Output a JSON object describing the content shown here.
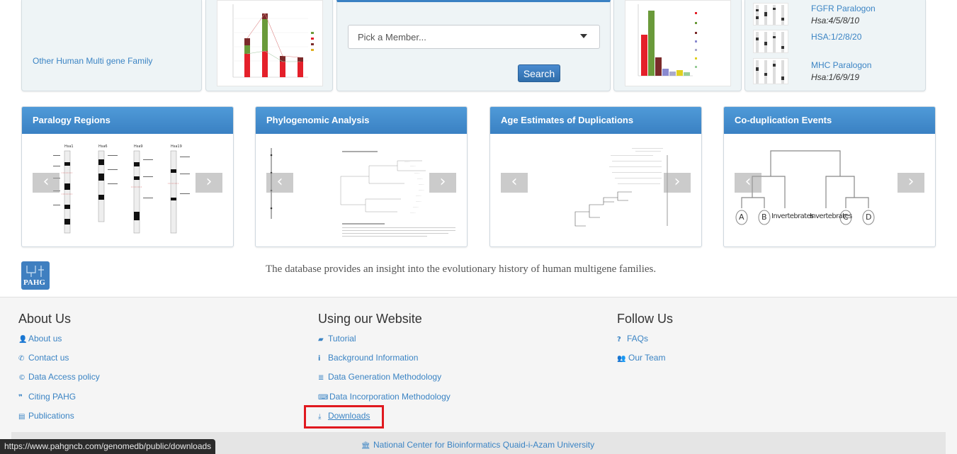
{
  "top_row": {
    "family_link": "Other Human Multi gene Family",
    "member_select_placeholder": "Pick a Member...",
    "search_button": "Search",
    "paralogons": [
      {
        "name": "FGFR Paralogon",
        "hsa": "Hsa:4/5/8/10"
      },
      {
        "name": "HSA:1/2/8/20",
        "hsa": ""
      },
      {
        "name": "MHC Paralogon",
        "hsa": "Hsa:1/6/9/19"
      }
    ]
  },
  "panels": [
    {
      "title": "Paralogy Regions"
    },
    {
      "title": "Phylogenomic Analysis"
    },
    {
      "title": "Age Estimates of Duplications"
    },
    {
      "title": "Co-duplication Events"
    }
  ],
  "tree_labels": [
    "A",
    "B",
    "Invertebrates",
    "Invertebrates",
    "C",
    "D"
  ],
  "logo_text": "PAHG",
  "tagline": "The database provides an insight into the evolutionary history of human multigene families.",
  "footer": {
    "about": {
      "title": "About Us",
      "items": [
        {
          "label": "About us",
          "icon": "user-icon"
        },
        {
          "label": "Contact us",
          "icon": "phone-icon"
        },
        {
          "label": "Data Access policy",
          "icon": "copyright-icon"
        },
        {
          "label": "Citing PAHG",
          "icon": "quote-icon"
        },
        {
          "label": "Publications",
          "icon": "newspaper-icon"
        }
      ]
    },
    "using": {
      "title": "Using our Website",
      "items": [
        {
          "label": "Tutorial",
          "icon": "book-icon"
        },
        {
          "label": "Background Information",
          "icon": "info-icon"
        },
        {
          "label": "Data Generation Methodology",
          "icon": "database-icon"
        },
        {
          "label": "Data Incorporation Methodology",
          "icon": "keyboard-icon"
        },
        {
          "label": "Downloads",
          "icon": "download-icon"
        }
      ]
    },
    "follow": {
      "title": "Follow Us",
      "items": [
        {
          "label": "FAQs",
          "icon": "question-icon"
        },
        {
          "label": "Our Team",
          "icon": "users-icon"
        }
      ]
    },
    "institution": "National Center for Bioinformatics Quaid-i-Azam University"
  },
  "status_bar_url": "https://www.pahgncb.com/genomedb/public/downloads",
  "colors": {
    "link": "#3b84c4",
    "panel_header": "#3a81c3",
    "button": "#3a78b8",
    "highlight": "#e0191f"
  }
}
